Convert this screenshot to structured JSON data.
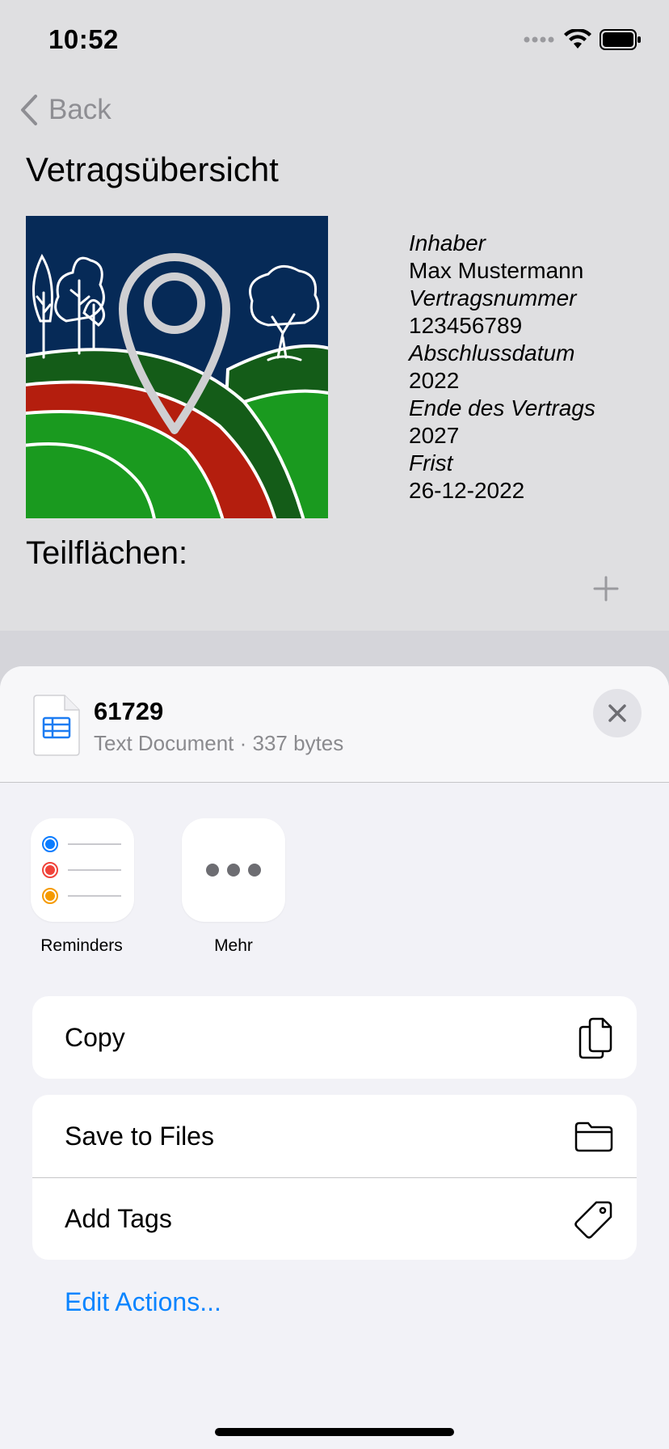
{
  "status": {
    "time": "10:52"
  },
  "nav": {
    "back_label": "Back"
  },
  "page": {
    "title": "Vetragsübersicht",
    "section_title": "Teilflächen:"
  },
  "contract": {
    "fields": [
      {
        "label": "Inhaber",
        "value": "Max Mustermann"
      },
      {
        "label": "Vertragsnummer",
        "value": "123456789"
      },
      {
        "label": "Abschlussdatum",
        "value": "2022"
      },
      {
        "label": "Ende des Vertrags",
        "value": "2027"
      },
      {
        "label": "Frist",
        "value": "26-12-2022"
      }
    ]
  },
  "share_sheet": {
    "file_name": "61729",
    "file_meta": "Text Document · 337 bytes",
    "apps": [
      {
        "label": "Reminders",
        "icon": "reminders-icon"
      },
      {
        "label": "Mehr",
        "icon": "more-icon"
      }
    ],
    "actions": {
      "copy": "Copy",
      "save_to_files": "Save to Files",
      "add_tags": "Add Tags"
    },
    "edit_actions": "Edit Actions..."
  },
  "colors": {
    "accent": "#0a84ff",
    "hero_bg": "#062a57",
    "field_red": "#b41e0e",
    "field_green_dark": "#145c18",
    "field_green": "#1a9a1f"
  }
}
